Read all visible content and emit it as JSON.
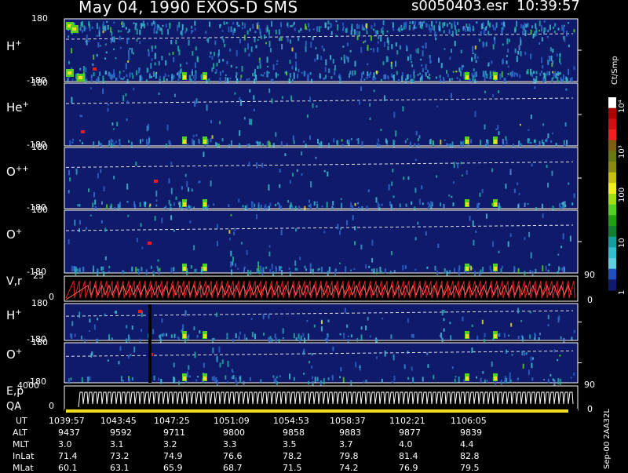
{
  "header": {
    "title": "May 04, 1990   EXOS-D SMS",
    "file": "s0050403.esr",
    "time": "10:39:57"
  },
  "colors": {
    "background": "#000000",
    "panel": "#101a6b",
    "accent_red": "#e02020",
    "accent_yellow": "#f0e020",
    "accent_cyan": "#40c0d8",
    "accent_green": "#50d020"
  },
  "chart_data": {
    "type": "heatmap",
    "panels": [
      {
        "name": "H+",
        "label_main": "H",
        "label_sup": "+",
        "ytop": "180",
        "ybot": "-180",
        "bg": "#101a6b"
      },
      {
        "name": "He+",
        "label_main": "He",
        "label_sup": "+",
        "ytop": "180",
        "ybot": "-180",
        "bg": "#101a6b"
      },
      {
        "name": "O++",
        "label_main": "O",
        "label_sup": "++",
        "ytop": "180",
        "ybot": "-180",
        "bg": "#101a6b"
      },
      {
        "name": "O+",
        "label_main": "O",
        "label_sup": "+",
        "ytop": "180",
        "ybot": "-180",
        "bg": "#101a6b"
      },
      {
        "name": "V,r",
        "label_main": "V,r",
        "label_sup": "",
        "ytop": "25",
        "ybot": "0",
        "right_label": "90",
        "right_label_bottom": "0"
      },
      {
        "name": "H+ (2)",
        "label_main": "H",
        "label_sup": "+",
        "ytop": "180",
        "ybot": "-180",
        "bg": "#101a6b"
      },
      {
        "name": "O+ (2)",
        "label_main": "O",
        "label_sup": "+",
        "ytop": "180",
        "ybot": "-180",
        "bg": "#101a6b"
      },
      {
        "name": "E,p",
        "label_main": "E,p",
        "label_sup": "",
        "ytop": "4000",
        "ybot": "0",
        "right_label": "90",
        "right_label_bottom": "0"
      }
    ],
    "qa_label": "QA",
    "colorbar": {
      "title": "Ct/Smp",
      "labels": [
        "10⁴",
        "10³",
        "100",
        "10",
        "1"
      ],
      "colors": [
        "#ffffff",
        "#b00000",
        "#d01010",
        "#f02020",
        "#7a6010",
        "#6a7a10",
        "#8a8a10",
        "#c8c010",
        "#f0f020",
        "#a0e010",
        "#50d020",
        "#20a010",
        "#108030",
        "#10a0a0",
        "#30c0d0",
        "#60d0e0",
        "#2050c0",
        "#101a6b"
      ]
    },
    "x_axis": {
      "UT": [
        "1039:57",
        "1043:45",
        "1047:25",
        "1051:09",
        "1054:53",
        "1058:37",
        "1102:21",
        "1106:05"
      ],
      "ALT": [
        "9437",
        "9592",
        "9711",
        "9800",
        "9858",
        "9883",
        "9877",
        "9839"
      ],
      "MLT": [
        "3.0",
        "3.1",
        "3.2",
        "3.3",
        "3.5",
        "3.7",
        "4.0",
        "4.4"
      ],
      "InLat": [
        "71.4",
        "73.2",
        "74.9",
        "76.6",
        "78.2",
        "79.8",
        "81.4",
        "82.8"
      ],
      "MLat": [
        "60.1",
        "63.1",
        "65.9",
        "68.7",
        "71.5",
        "74.2",
        "76.9",
        "79.5"
      ]
    },
    "footer_note": "Sep-00  2AA32L"
  }
}
